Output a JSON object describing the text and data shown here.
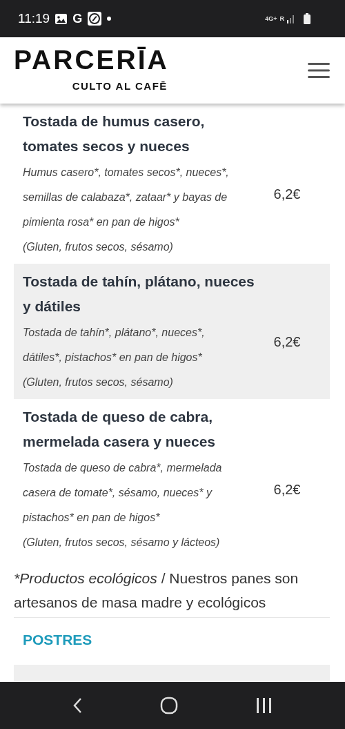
{
  "status_bar": {
    "time": "11:19",
    "g_label": "G",
    "network": "4G+",
    "roaming": "R"
  },
  "header": {
    "brand": "PARCERĪA",
    "tagline": "CULTO AL CAFĒ"
  },
  "items": [
    {
      "title": "Tostada de humus casero, tomates secos y nueces",
      "description": "Humus casero*, tomates secos*, nueces*, semillas de calabaza*, zataar* y bayas de pimienta rosa* en pan de higos*",
      "allergens": "(Gluten, frutos secos, sésamo)",
      "price": "6,2€",
      "shaded": false
    },
    {
      "title": "Tostada de tahín, plátano, nueces y dátiles",
      "description": "Tostada de tahín*, plátano*, nueces*, dátiles*, pistachos* en pan de higos*",
      "allergens": "(Gluten, frutos secos, sésamo)",
      "price": "6,2€",
      "shaded": true
    },
    {
      "title": "Tostada de queso de cabra, mermelada casera y nueces",
      "description": "Tostada de queso de cabra*, mermelada casera de tomate*, sésamo, nueces* y pistachos* en pan de higos*",
      "allergens": "(Gluten, frutos secos, sésamo y lácteos)",
      "price": "6,2€",
      "shaded": false
    }
  ],
  "footnote": {
    "italic_part": "*Productos ecológicos",
    "rest": " / Nuestros panes son artesanos de masa madre y ecológicos"
  },
  "next_section": {
    "title": "POSTRES"
  }
}
